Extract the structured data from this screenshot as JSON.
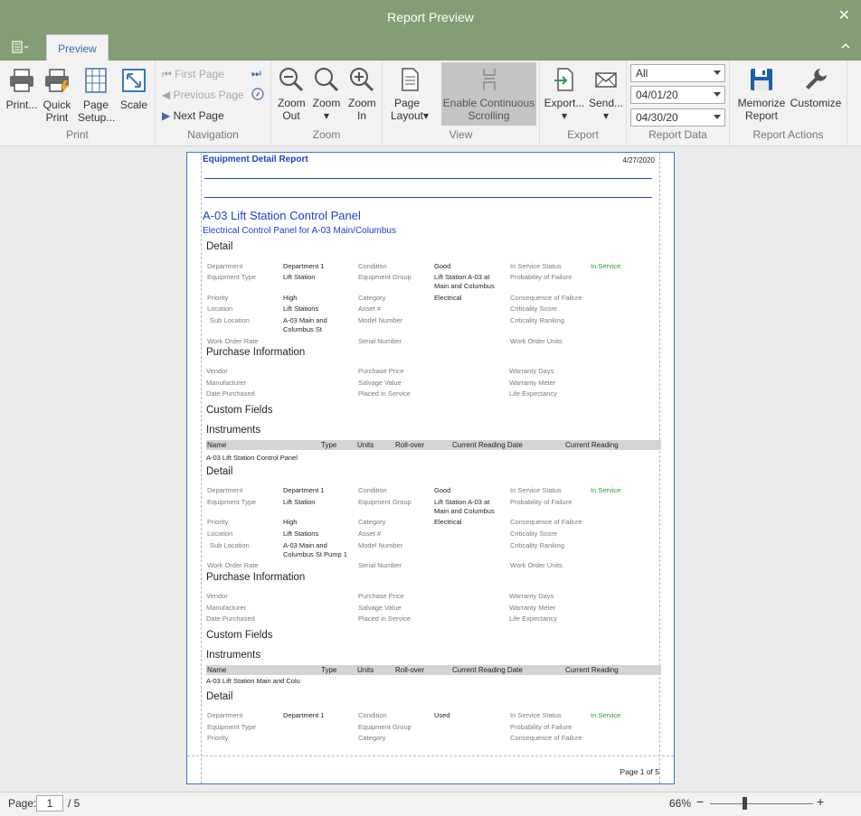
{
  "window": {
    "title": "Report Preview",
    "close_icon": "close-icon"
  },
  "tabs": [
    {
      "label": "Preview"
    }
  ],
  "ribbon": {
    "print": {
      "label": "Print",
      "print": "Print...",
      "quick_print": "Quick Print",
      "page_setup": "Page Setup...",
      "scale": "Scale"
    },
    "navigation": {
      "label": "Navigation",
      "first": "First Page",
      "previous": "Previous Page",
      "next": "Next Page"
    },
    "zoom": {
      "label": "Zoom",
      "zoom_out": "Zoom Out",
      "zoom": "Zoom",
      "zoom_in": "Zoom In"
    },
    "view": {
      "label": "View",
      "page_layout": "Page Layout",
      "continuous": "Enable Continuous Scrolling"
    },
    "export": {
      "label": "Export",
      "export": "Export...",
      "send": "Send..."
    },
    "report_data": {
      "label": "Report Data",
      "filter": "All",
      "start_date": "04/01/20",
      "end_date": "04/30/20"
    },
    "report_actions": {
      "label": "Report Actions",
      "memorize": "Memorize Report",
      "customize": "Customize"
    }
  },
  "report": {
    "title": "Equipment Detail Report",
    "date": "4/27/2020",
    "equipment_name": "A-03 Lift Station Control Panel",
    "equipment_desc": "Electrical Control Panel for A-03 Main/Columbus",
    "page_footer": "Page 1 of 5",
    "sections": {
      "detail": "Detail",
      "purchase": "Purchase Information",
      "custom": "Custom Fields",
      "instruments": "Instruments"
    },
    "labels": {
      "department": "Department",
      "equipment_type": "Equipment Type",
      "priority": "Priority",
      "location": "Location",
      "sub_location": "Sub Location",
      "work_order_rate": "Work Order Rate",
      "condition": "Condition",
      "equipment_group": "Equipment Group",
      "category": "Category",
      "asset_no": "Asset #",
      "model_number": "Model Number",
      "serial_number": "Serial Number",
      "in_service_status": "In Service Status",
      "probability_of_failure": "Probability of Failure",
      "consequence_of_failure": "Consequence of Failure",
      "criticality_score": "Criticality Score",
      "criticality_ranking": "Criticality Ranking",
      "work_order_units": "Work Order Units",
      "vendor": "Vendor",
      "manufacturer": "Manufacturer",
      "date_purchased": "Date Purchased",
      "purchase_price": "Purchase Price",
      "salvage_value": "Salvage Value",
      "placed_in_service": "Placed in Service",
      "warranty_days": "Warranty Days",
      "warranty_meter": "Warranty Meter",
      "life_expectancy": "Life Expectancy"
    },
    "instrument_columns": [
      "Name",
      "Type",
      "Units",
      "Roll-over",
      "Current Reading Date",
      "Current Reading"
    ],
    "blocks": [
      {
        "department": "Department 1",
        "equipment_type": "Lift Station",
        "priority": "High",
        "location": "Lift Stations",
        "sub_location": "A-03 Main and Columbus St",
        "condition": "Good",
        "equipment_group": "Lift Station A-03 at Main and Columbus",
        "category": "Electrical",
        "in_service_status": "In Service",
        "instrument_row": "A-03 Lift Station Control Panel"
      },
      {
        "department": "Department 1",
        "equipment_type": "Lift Station",
        "priority": "High",
        "location": "Lift Stations",
        "sub_location": "A-03 Main and Columbus St Pump 1",
        "condition": "Good",
        "equipment_group": "Lift Station A-03 at Main and Columbus",
        "category": "Electrical",
        "in_service_status": "In Service",
        "instrument_row": "A-03 Lift Station Main and Colu"
      },
      {
        "department": "Department 1",
        "condition": "Used",
        "in_service_status": "In Service"
      }
    ]
  },
  "status": {
    "page_label": "Page:",
    "page_value": "1",
    "page_total": "/ 5",
    "zoom_level": "66%",
    "zoom_fraction": 0.33
  },
  "colors": {
    "titlebar": "#839d77",
    "accent": "#1f3fd0",
    "in_service": "#2e9a2e",
    "tab_text": "#3a6ea5"
  }
}
